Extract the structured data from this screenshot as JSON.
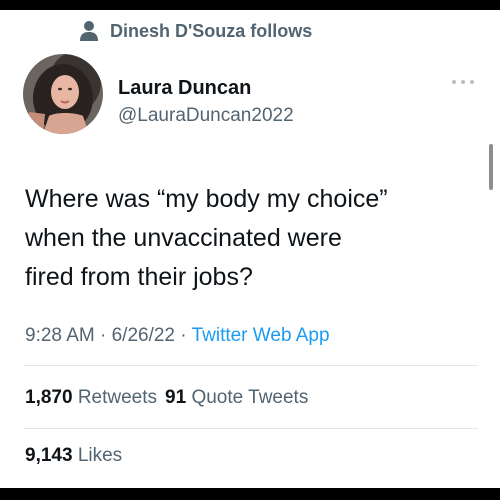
{
  "social_context": {
    "icon": "person-icon",
    "text": "Dinesh D'Souza follows"
  },
  "author": {
    "name": "Laura Duncan",
    "handle": "@LauraDuncan2022",
    "avatar_icon": "profile-avatar"
  },
  "more_icon": "more-options-icon",
  "tweet": {
    "lines": [
      "Where was “my body my choice”",
      "when the unvaccinated were",
      "fired from their jobs?"
    ]
  },
  "meta": {
    "time": "9:28 AM",
    "separator": "·",
    "date": "6/26/22",
    "source": "Twitter Web App"
  },
  "stats": {
    "retweets_count": "1,870",
    "retweets_label": "Retweets",
    "quotes_count": "91",
    "quotes_label": "Quote Tweets",
    "likes_count": "9,143",
    "likes_label": "Likes"
  },
  "colors": {
    "text_primary": "#0f1419",
    "text_secondary": "#536471",
    "link": "#1d9bf0",
    "divider": "#e3e6e9"
  }
}
